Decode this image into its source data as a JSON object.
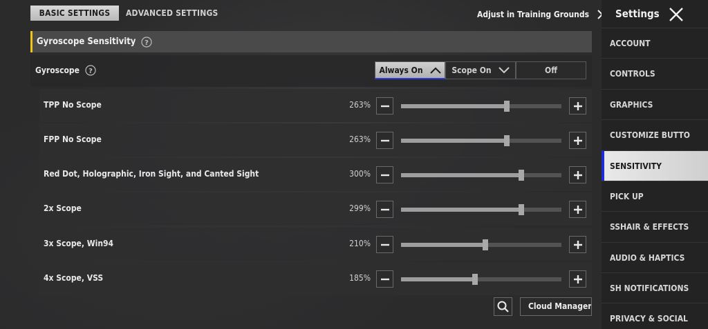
{
  "tabs": [
    {
      "label": "BASIC SETTINGS",
      "active": true
    },
    {
      "label": "ADVANCED SETTINGS",
      "active": false
    }
  ],
  "training_link": "Adjust in Training Grounds",
  "sidebar": {
    "title": "Settings",
    "items": [
      {
        "label": "ACCOUNT"
      },
      {
        "label": "CONTROLS"
      },
      {
        "label": "GRAPHICS"
      },
      {
        "label": "CUSTOMIZE BUTTO"
      },
      {
        "label": "SENSITIVITY",
        "active": true
      },
      {
        "label": "PICK UP"
      },
      {
        "label": "SSHAIR & EFFECTS"
      },
      {
        "label": "AUDIO & HAPTICS"
      },
      {
        "label": "SH NOTIFICATIONS"
      },
      {
        "label": "PRIVACY & SOCIAL"
      }
    ]
  },
  "section": {
    "title": "Gyroscope Sensitivity"
  },
  "gyroscope": {
    "label": "Gyroscope",
    "options": [
      {
        "label": "Always On",
        "active": true,
        "icon": "chevron-up-icon"
      },
      {
        "label": "Scope On",
        "active": false,
        "icon": "chevron-down-icon"
      },
      {
        "label": "Off",
        "active": false
      }
    ]
  },
  "rows": [
    {
      "label": "TPP No Scope",
      "value": "263%",
      "fraction": 0.66
    },
    {
      "label": "FPP No Scope",
      "value": "263%",
      "fraction": 0.66
    },
    {
      "label": "Red Dot, Holographic, Iron Sight, and Canted Sight",
      "value": "300%",
      "fraction": 0.75
    },
    {
      "label": "2x Scope",
      "value": "299%",
      "fraction": 0.75
    },
    {
      "label": "3x Scope, Win94",
      "value": "210%",
      "fraction": 0.525
    },
    {
      "label": "4x Scope, VSS",
      "value": "185%",
      "fraction": 0.46
    }
  ],
  "bottom": {
    "cloud_label": "Cloud Manageme"
  },
  "colors": {
    "accent_blue": "#2d39d9",
    "section_marker": "#f0c419"
  }
}
